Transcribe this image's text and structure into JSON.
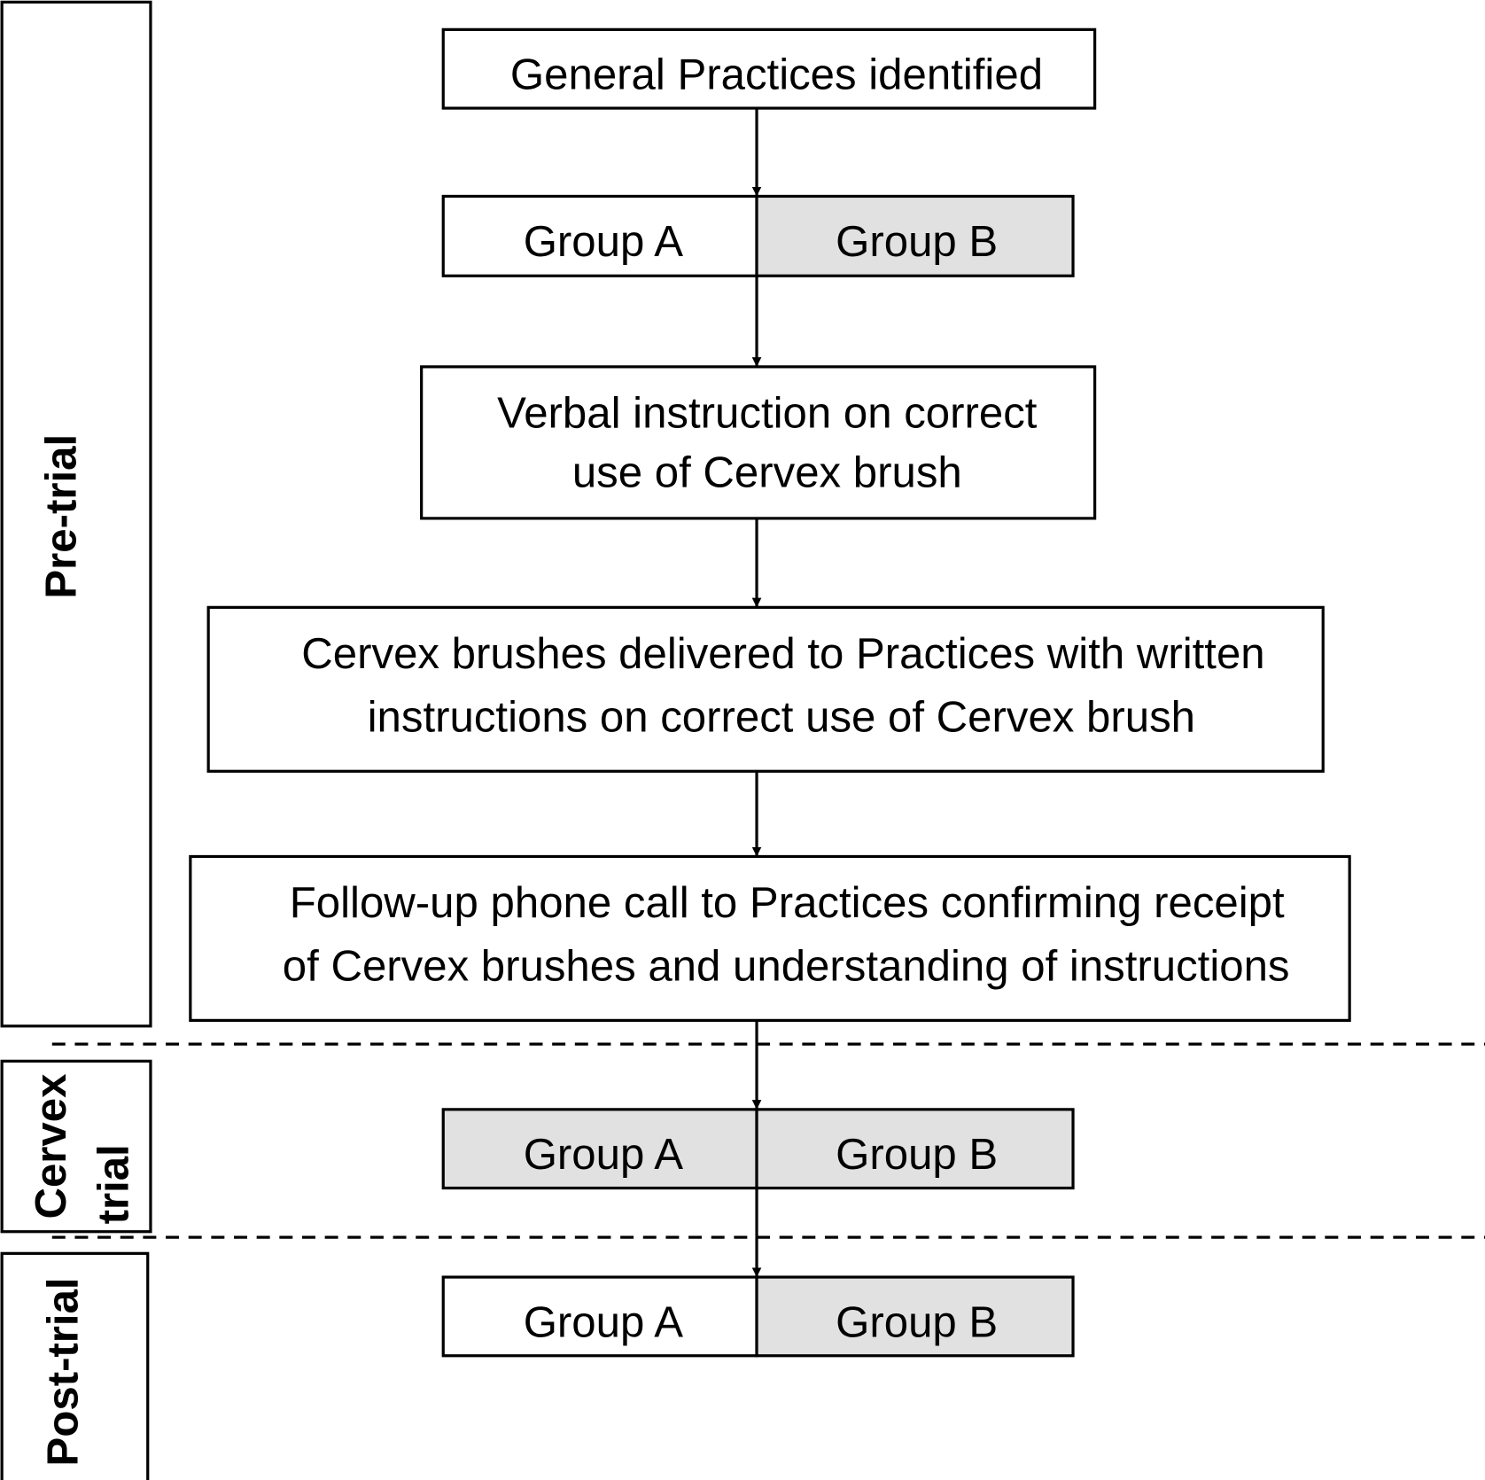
{
  "phases": {
    "pre_trial": "Pre-trial",
    "cervex_trial_line1": "Cervex",
    "cervex_trial_line2": "trial",
    "post_trial": "Post-trial"
  },
  "steps": {
    "identified": "General Practices identified",
    "verbal": [
      "Verbal instruction on correct",
      "use of Cervex brush"
    ],
    "delivered": [
      "Cervex brushes delivered to Practices with written",
      "instructions on correct use of Cervex brush"
    ],
    "followup": [
      "Follow-up phone call to Practices confirming receipt",
      "of Cervex brushes and understanding of instructions"
    ]
  },
  "groups": {
    "pre": {
      "a": "Group A",
      "b": "Group B"
    },
    "trial": {
      "a": "Group A",
      "b": "Group B"
    },
    "post": {
      "a": "Group A",
      "b": "Group B"
    }
  },
  "colors": {
    "shaded": "#e1e1e1",
    "line": "#000000"
  }
}
